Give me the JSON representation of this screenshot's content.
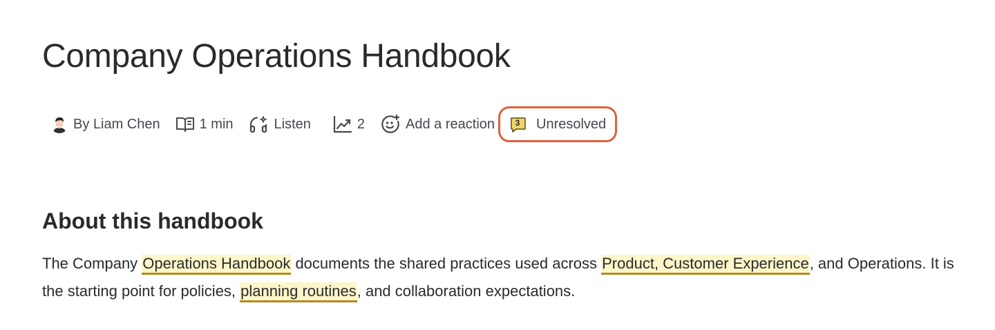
{
  "page": {
    "title": "Company Operations Handbook"
  },
  "byline": {
    "author": "By Liam Chen",
    "read_time": "1 min",
    "listen_label": "Listen",
    "views_count": "2",
    "reaction_label": "Add a reaction",
    "unresolved_count": "3",
    "unresolved_label": "Unresolved"
  },
  "section": {
    "heading": "About this handbook",
    "paragraph": [
      "The Company ",
      "Operations Handbook",
      " documents the shared practices used across ",
      "Product, Customer Experience",
      ", and Operations. It is the starting point for policies, ",
      "planning routines",
      ", and collaboration expectations."
    ]
  },
  "colors": {
    "highlight_background": "#fdf6c8",
    "highlight_underline": "#b38a20",
    "callout_border": "#e0603a",
    "comment_badge": "#f0d66a"
  }
}
